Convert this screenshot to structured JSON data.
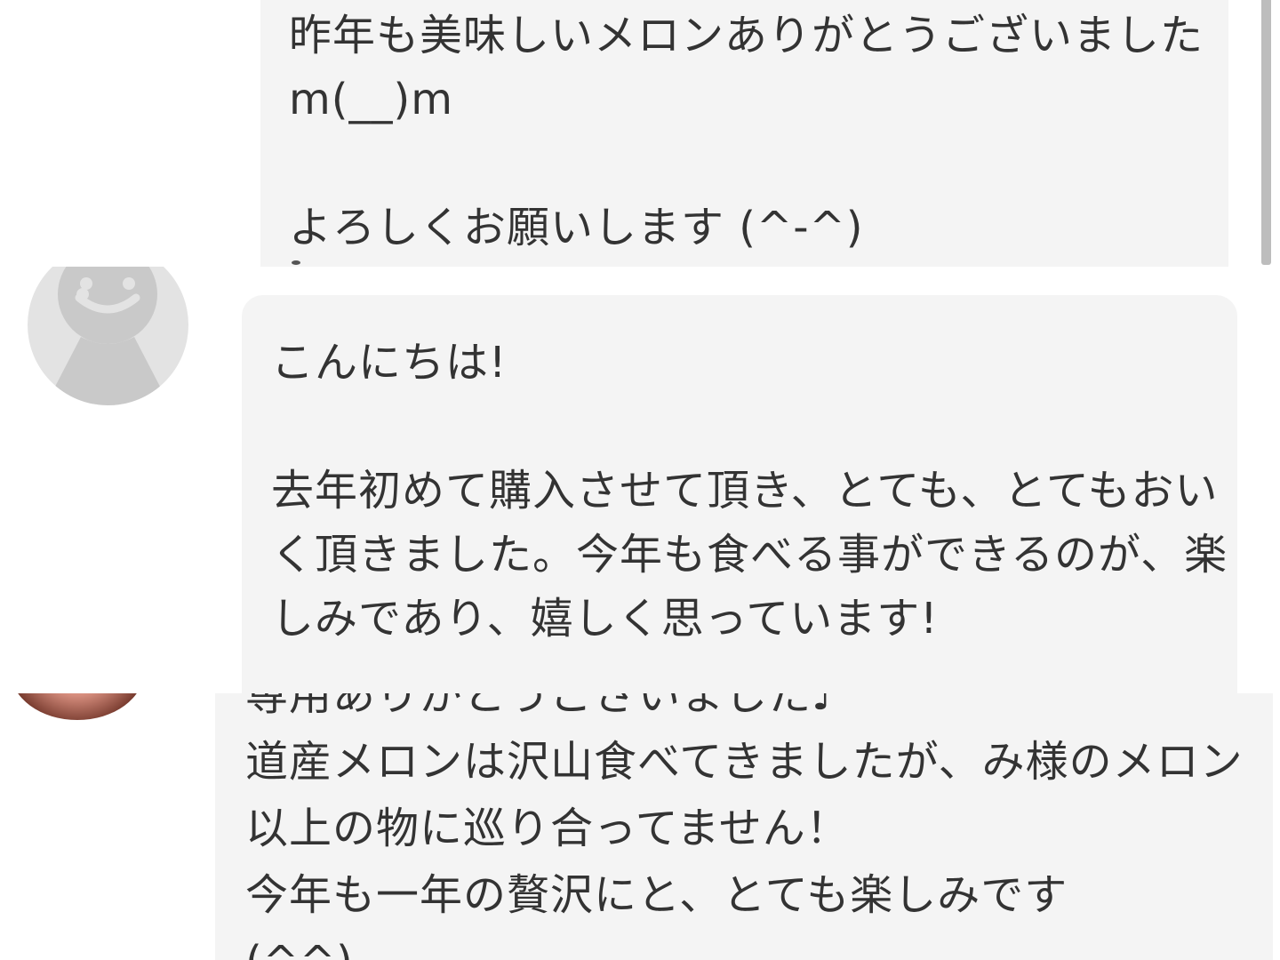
{
  "review_1": {
    "text": "昨年も美味しいメロンありがとうございました m(__)m\n\nよろしくお願いします (^-^)"
  },
  "review_2": {
    "text": "こんにちは!\n\n去年初めて購入させて頂き、とても、とてもおいく頂きました。今年も食べる事ができるのが、楽しみであり、嬉しく思っています!"
  },
  "review_3": {
    "text": "専用ありがとうございました♪\n道産メロンは沢山食べてきましたが、み様のメロン以上の物に巡り合ってません！\n今年も一年の贅沢にと、とても楽しみです\n(^^)"
  },
  "icons": {
    "default_avatar": "default-user-avatar-icon",
    "user_photo": "user-photo-avatar"
  },
  "colors": {
    "bubble_bg": "#f4f4f4",
    "avatar_bg": "#e3e3e3",
    "avatar_fg": "#c9c9c9",
    "text": "#333333"
  }
}
